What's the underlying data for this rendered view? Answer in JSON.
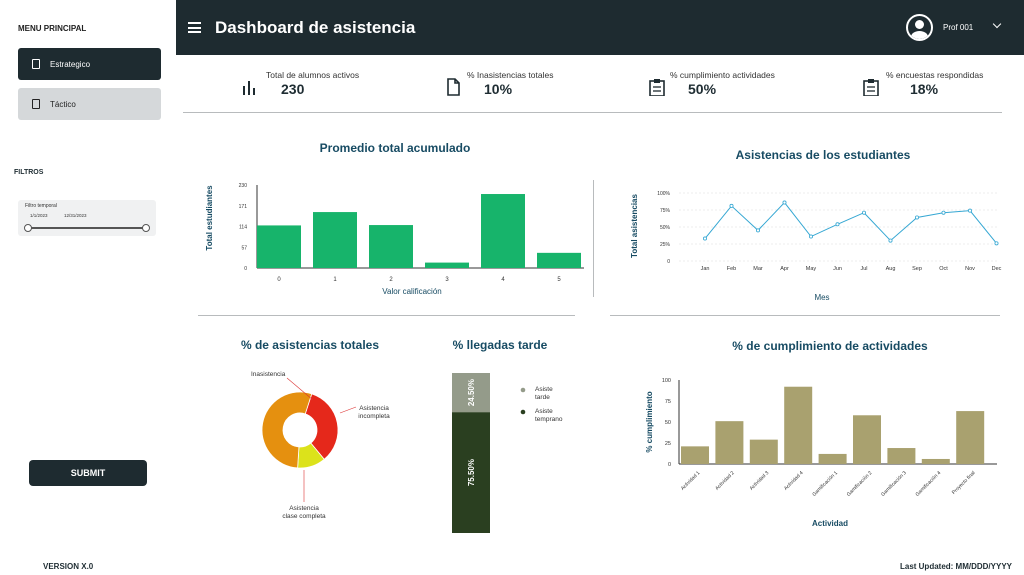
{
  "sidebar": {
    "title": "MENU PRINCIPAL",
    "items": [
      {
        "label": "Estrategico"
      },
      {
        "label": "Táctico"
      }
    ],
    "filters_title": "FILTROS",
    "filter_label": "Filtro temporal",
    "date_from": "1/1/2023",
    "date_to": "12/31/2023",
    "submit": "SUBMIT",
    "version": "VERSION X.0"
  },
  "header": {
    "title": "Dashboard de asistencia",
    "user": "Prof 001"
  },
  "kpis": [
    {
      "label": "Total de alumnos activos",
      "value": "230",
      "icon": "bar-chart-icon"
    },
    {
      "label": "% Inasistencias totales",
      "value": "10%",
      "icon": "document-icon"
    },
    {
      "label": "% cumplimiento actividades",
      "value": "50%",
      "icon": "clipboard-icon"
    },
    {
      "label": "% encuestas respondidas",
      "value": "18%",
      "icon": "clipboard-icon"
    }
  ],
  "footer": "Last Updated: MM/DDD/YYYY",
  "chart_data": [
    {
      "type": "bar",
      "title": "Promedio total acumulado",
      "xlabel": "Valor calificación",
      "ylabel": "Total estudiantes",
      "categories": [
        "0",
        "1",
        "2",
        "3",
        "4",
        "5"
      ],
      "values": [
        118,
        155,
        119,
        15,
        205,
        42
      ],
      "yticks": [
        "0",
        "57",
        "114",
        "171",
        "230"
      ],
      "ylim": [
        0,
        230
      ],
      "color": "#17b46b"
    },
    {
      "type": "line",
      "title": "Asistencias de los estudiantes",
      "xlabel": "Mes",
      "ylabel": "Total asistencias",
      "categories": [
        "Jan",
        "Feb",
        "Mar",
        "Apr",
        "May",
        "Jun",
        "Jul",
        "Aug",
        "Sep",
        "Oct",
        "Nov",
        "Dec"
      ],
      "values": [
        33,
        81,
        45,
        86,
        36,
        54,
        71,
        30,
        64,
        71,
        74,
        26
      ],
      "yticks": [
        "0",
        "25%",
        "50%",
        "75%",
        "100%"
      ],
      "ylim": [
        0,
        100
      ],
      "color": "#35a7d3"
    },
    {
      "type": "pie",
      "title": "% de asistencias totales",
      "labels": [
        "Inasistencia",
        "Asistencia incompleta",
        "Asistencia clase completa"
      ],
      "values": [
        34,
        12,
        54
      ],
      "colors": [
        "#e5281b",
        "#dce21b",
        "#e5900f"
      ]
    },
    {
      "type": "bar",
      "title": "% llegadas tarde",
      "labels": [
        "Asiste tarde",
        "Asiste temprano"
      ],
      "values": [
        24.5,
        75.5
      ],
      "value_labels": [
        "24.50%",
        "75.50%"
      ],
      "colors": [
        "#949b8a",
        "#2a3f20"
      ]
    },
    {
      "type": "bar",
      "title": "% de cumplimiento de actividades",
      "xlabel": "Actividad",
      "ylabel": "% cumplimiento",
      "categories": [
        "Actividad 1",
        "Actividad 2",
        "Actividad 3",
        "Actividad 4",
        "Gamificación 1",
        "Gamificación 2",
        "Gamificación 3",
        "Gamificación 4",
        "Proyecto final"
      ],
      "values": [
        21,
        51,
        29,
        92,
        12,
        58,
        19,
        6,
        63
      ],
      "yticks": [
        "0",
        "25",
        "50",
        "75",
        "100"
      ],
      "ylim": [
        0,
        100
      ],
      "color": "#a9a16f"
    }
  ]
}
